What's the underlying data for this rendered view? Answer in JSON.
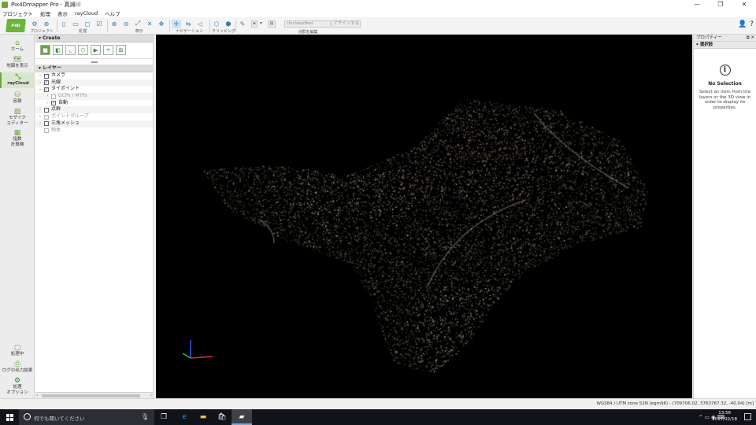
{
  "window": {
    "title": "Pix4Dmapper Pro - 真淵川",
    "controls": [
      "—",
      "❐",
      "✕"
    ]
  },
  "menu": [
    "プロジェクト",
    "処理",
    "表示",
    "rayCloud",
    "ヘルプ"
  ],
  "toolbar": {
    "groups": [
      {
        "label": "プロジェクト"
      },
      {
        "label": "処理"
      },
      {
        "label": "表示"
      },
      {
        "label": "ナビゲーション"
      },
      {
        "label": "クリッピング"
      },
      {
        "label": "点群を編集"
      }
    ],
    "class_select_value": "Unclassified",
    "assign_button_label": "アサインする"
  },
  "nav": {
    "items": [
      {
        "label": "ホーム",
        "icon": "home-icon"
      },
      {
        "label": "地図を表示",
        "icon": "map-icon"
      },
      {
        "label": "rayCloud",
        "icon": "raycloud-icon",
        "active": true
      },
      {
        "label": "容積",
        "icon": "volume-icon"
      },
      {
        "label": "モザイク\nエディター",
        "icon": "mosaic-icon"
      },
      {
        "label": "指数\n計算機",
        "icon": "index-calculator-icon"
      }
    ],
    "bottom_items": [
      {
        "label": "処理中",
        "icon": "processing-icon"
      },
      {
        "label": "ログの出力結果",
        "icon": "log-icon"
      },
      {
        "label": "処理\nオプション",
        "icon": "gear-icon"
      }
    ]
  },
  "layers": {
    "create_header": "Create",
    "layers_header": "レイヤー",
    "tree": [
      {
        "label": "カメラ",
        "level": 0,
        "checked": false,
        "arrow": ">"
      },
      {
        "label": "光線",
        "level": 0,
        "checked": true,
        "arrow": ">"
      },
      {
        "label": "タイポイント",
        "level": 0,
        "checked": true,
        "arrow": "v"
      },
      {
        "label": "GCPs / MTPs",
        "level": 1,
        "checked": false,
        "arrow": ">",
        "dim": true
      },
      {
        "label": "自動",
        "level": 1,
        "checked": true,
        "arrow": ">"
      },
      {
        "label": "点群",
        "level": 0,
        "checked": false,
        "arrow": ">"
      },
      {
        "label": "ポイントグループ",
        "level": 0,
        "checked": false,
        "arrow": ">",
        "dim": true
      },
      {
        "label": "三角メッシュ",
        "level": 0,
        "checked": false,
        "arrow": ">"
      },
      {
        "label": "物体",
        "level": 0,
        "checked": false,
        "arrow": "",
        "dim": true
      }
    ]
  },
  "properties": {
    "header": "プロパティー",
    "section": "選択肢",
    "title": "No Selection",
    "description": "Select an item from the layers or the 3D view in order to display its properties."
  },
  "status": {
    "coords": "WGS84 / UTM zone 52N (egm96) - (709706.02, 3763767.32, -40.04) [m]"
  },
  "taskbar": {
    "search_placeholder": "何でも聞いてください",
    "tray": "^  ▭  ◉  ⌨",
    "time": "13:56",
    "date": "2017/02/18"
  },
  "colors": {
    "accent": "#6ba539",
    "viewport_bg": "#000000",
    "axis_x": "#e03030",
    "axis_y": "#30c030",
    "axis_z": "#3050e0"
  }
}
